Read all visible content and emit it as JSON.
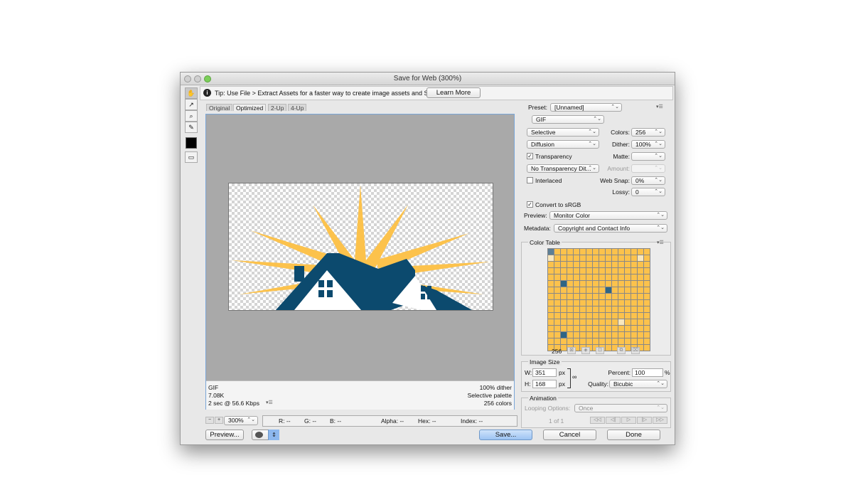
{
  "window": {
    "title": "Save for Web (300%)"
  },
  "tools": [
    {
      "name": "hand-tool",
      "glyph": "✋"
    },
    {
      "name": "slice-select-tool",
      "glyph": "↗"
    },
    {
      "name": "zoom-tool",
      "glyph": "🔍"
    },
    {
      "name": "eyedropper-tool",
      "glyph": "✎"
    }
  ],
  "tip": {
    "text": "Tip: Use File > Extract Assets for a faster way to create image assets and SVG",
    "button": "Learn More"
  },
  "tabs": [
    "Original",
    "Optimized",
    "2-Up",
    "4-Up"
  ],
  "status": {
    "left": [
      "GIF",
      "7.08K",
      "2 sec @ 56.6 Kbps"
    ],
    "right": [
      "100% dither",
      "Selective palette",
      "256 colors"
    ]
  },
  "zoom": {
    "value": "300%"
  },
  "readout": {
    "r": "R: --",
    "g": "G: --",
    "b": "B: --",
    "alpha": "Alpha: --",
    "hex": "Hex: --",
    "index": "Index: --"
  },
  "buttons": {
    "preview": "Preview...",
    "save": "Save...",
    "cancel": "Cancel",
    "done": "Done"
  },
  "settings": {
    "preset_label": "Preset:",
    "preset": "[Unnamed]",
    "format": "GIF",
    "reduction": "Selective",
    "dither_algo": "Diffusion",
    "colors_label": "Colors:",
    "colors": "256",
    "dither_label": "Dither:",
    "dither": "100%",
    "transparency": "Transparency",
    "matte_label": "Matte:",
    "transp_dither": "No Transparency Dit...",
    "amount_label": "Amount:",
    "interlaced": "Interlaced",
    "websnap_label": "Web Snap:",
    "websnap": "0%",
    "lossy_label": "Lossy:",
    "lossy": "0",
    "convert": "Convert to sRGB",
    "preview_label": "Preview:",
    "preview": "Monitor Color",
    "metadata_label": "Metadata:",
    "metadata": "Copyright and Contact Info"
  },
  "color_table": {
    "title": "Color Table",
    "count": "256"
  },
  "image_size": {
    "title": "Image Size",
    "w_label": "W:",
    "w": "351",
    "h_label": "H:",
    "h": "168",
    "unit": "px",
    "percent_label": "Percent:",
    "percent": "100",
    "percent_unit": "%",
    "quality_label": "Quality:",
    "quality": "Bicubic"
  },
  "animation": {
    "title": "Animation",
    "looping_label": "Looping Options:",
    "looping": "Once",
    "frame": "1 of 1"
  },
  "colors": {
    "navy": "#0c4a6e",
    "sun": "#fcc24c",
    "accent_blue": "#9cc3f2"
  }
}
